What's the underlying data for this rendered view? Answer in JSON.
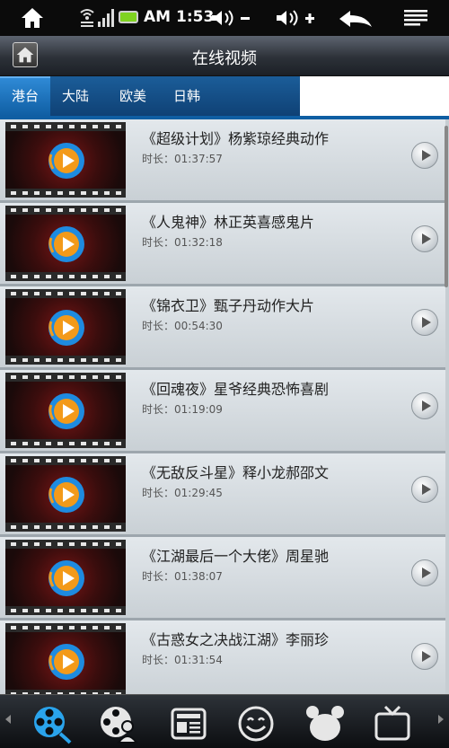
{
  "status_bar": {
    "time": "AM 1:53",
    "battery_color": "#7fd321"
  },
  "header": {
    "title": "在线视频"
  },
  "tabs": [
    {
      "label": "港台",
      "active": true
    },
    {
      "label": "大陆",
      "active": false
    },
    {
      "label": "欧美",
      "active": false
    },
    {
      "label": "日韩",
      "active": false
    }
  ],
  "videos": [
    {
      "title": "《超级计划》杨紫琼经典动作",
      "duration": "时长：01:37:57"
    },
    {
      "title": "《人鬼神》林正英喜感鬼片",
      "duration": "时长：01:32:18"
    },
    {
      "title": "《锦衣卫》甄子丹动作大片",
      "duration": "时长：00:54:30"
    },
    {
      "title": "《回魂夜》星爷经典恐怖喜剧",
      "duration": "时长：01:19:09"
    },
    {
      "title": "《无敌反斗星》释小龙郝邵文",
      "duration": "时长：01:29:45"
    },
    {
      "title": "《江湖最后一个大佬》周星驰",
      "duration": "时长：01:38:07"
    },
    {
      "title": "《古惑女之决战江湖》李丽珍",
      "duration": "时长：01:31:54"
    }
  ],
  "bottom_nav": [
    {
      "icon": "film-reel-icon",
      "active": true
    },
    {
      "icon": "reel-person-icon",
      "active": false
    },
    {
      "icon": "news-icon",
      "active": false
    },
    {
      "icon": "smiley-icon",
      "active": false
    },
    {
      "icon": "bear-icon",
      "active": false
    },
    {
      "icon": "tv-icon",
      "active": false
    }
  ],
  "colors": {
    "tab_active": "#2f8ad6",
    "tab_bar": "#0f4175",
    "accent_blue": "#1f8fe0"
  }
}
